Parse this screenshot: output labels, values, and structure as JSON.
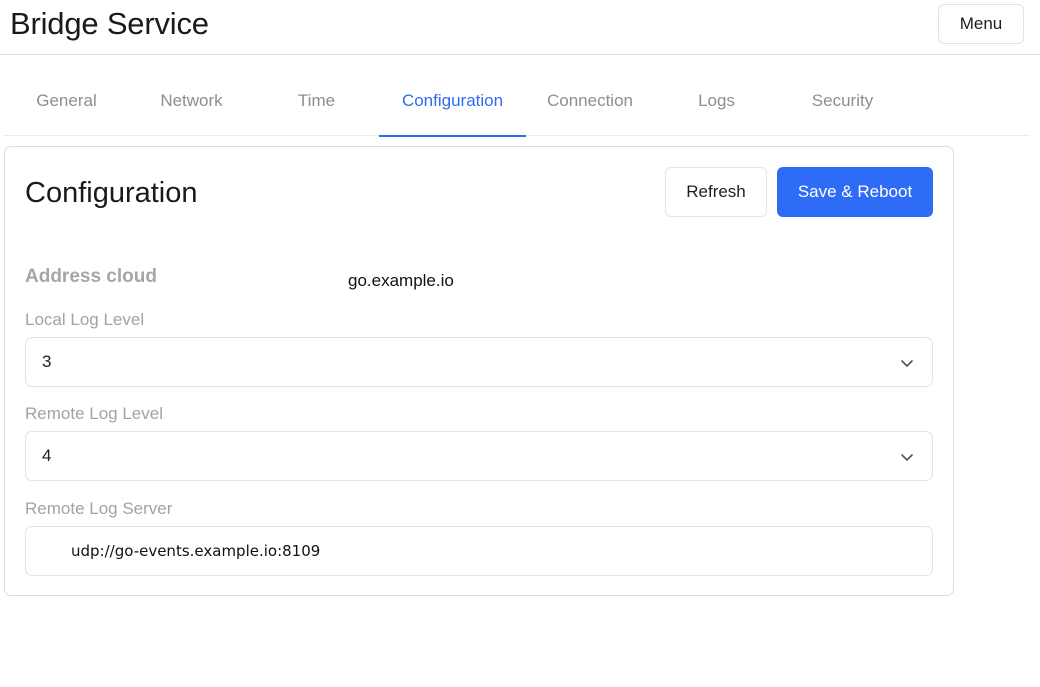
{
  "header": {
    "title": "Bridge Service",
    "menu_label": "Menu"
  },
  "tabs": [
    {
      "label": "General"
    },
    {
      "label": "Network"
    },
    {
      "label": "Time"
    },
    {
      "label": "Configuration"
    },
    {
      "label": "Connection"
    },
    {
      "label": "Logs"
    },
    {
      "label": "Security"
    }
  ],
  "active_tab": "Configuration",
  "colors": {
    "accent": "#2f6cf6",
    "muted_text": "#a3a3a3",
    "border": "#e3e3e3"
  },
  "config": {
    "title": "Configuration",
    "refresh_label": "Refresh",
    "save_label": "Save & Reboot",
    "address_cloud": {
      "label": "Address cloud",
      "value": "go.example.io"
    },
    "local_log_level": {
      "label": "Local Log Level",
      "value": "3"
    },
    "remote_log_level": {
      "label": "Remote Log Level",
      "value": "4"
    },
    "remote_log_server": {
      "label": "Remote Log Server",
      "value": "udp://go-events.example.io:8109"
    }
  }
}
